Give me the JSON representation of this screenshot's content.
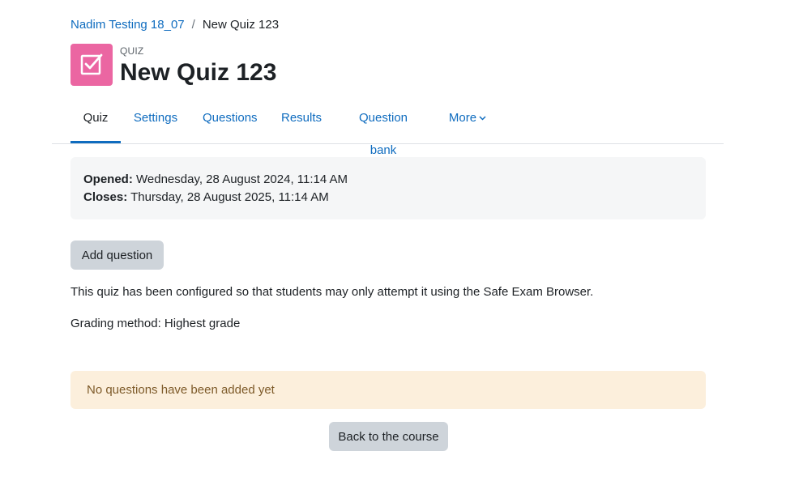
{
  "breadcrumb": {
    "course": "Nadim Testing 18_07",
    "separator": "/",
    "current": "New Quiz 123"
  },
  "header": {
    "kind": "QUIZ",
    "title": "New Quiz 123",
    "icon": "checkbox-icon",
    "icon_color": "#eb66a2"
  },
  "tabs": [
    {
      "label": "Quiz",
      "active": true
    },
    {
      "label": "Settings",
      "active": false
    },
    {
      "label": "Questions",
      "active": false
    },
    {
      "label": "Results",
      "active": false
    },
    {
      "label": "Question bank",
      "active": false
    },
    {
      "label": "More",
      "active": false
    }
  ],
  "dates": {
    "opened_label": "Opened:",
    "opened_value": "Wednesday, 28 August 2024, 11:14 AM",
    "closes_label": "Closes:",
    "closes_value": "Thursday, 28 August 2025, 11:14 AM"
  },
  "actions": {
    "add_question": "Add question",
    "back_to_course": "Back to the course"
  },
  "info": {
    "seb_notice": "This quiz has been configured so that students may only attempt it using the Safe Exam Browser.",
    "grading_method": "Grading method: Highest grade"
  },
  "alert": {
    "message": "No questions have been added yet"
  },
  "colors": {
    "link": "#0f6cbf",
    "alert_bg": "#fcefdc",
    "button_bg": "#ced4da"
  }
}
